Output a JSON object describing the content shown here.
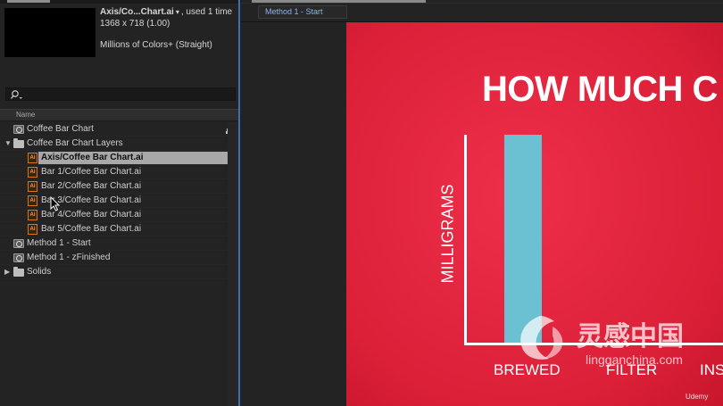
{
  "project": {
    "info": {
      "file_name": "Axis/Co...Chart.ai",
      "caret": "▾",
      "usage": ", used 1 time",
      "dimensions": "1368 x 718 (1.00)",
      "color_mode": "Millions of Colors+ (Straight)"
    },
    "column_header": "Name",
    "items": [
      {
        "label": "Coffee Bar Chart",
        "icon": "composition-icon",
        "indent": 0
      },
      {
        "label": "Coffee Bar Chart Layers",
        "icon": "folder-icon",
        "indent": 0,
        "expanded": true
      },
      {
        "label": "Axis/Coffee Bar Chart.ai",
        "icon": "illustrator-file-icon",
        "indent": 1,
        "selected": true
      },
      {
        "label": "Bar 1/Coffee Bar Chart.ai",
        "icon": "illustrator-file-icon",
        "indent": 1
      },
      {
        "label": "Bar 2/Coffee Bar Chart.ai",
        "icon": "illustrator-file-icon",
        "indent": 1
      },
      {
        "label": "Bar 3/Coffee Bar Chart.ai",
        "icon": "illustrator-file-icon",
        "indent": 1
      },
      {
        "label": "Bar 4/Coffee Bar Chart.ai",
        "icon": "illustrator-file-icon",
        "indent": 1
      },
      {
        "label": "Bar 5/Coffee Bar Chart.ai",
        "icon": "illustrator-file-icon",
        "indent": 1
      },
      {
        "label": "Method 1 - Start",
        "icon": "composition-icon",
        "indent": 0
      },
      {
        "label": "Method 1 - zFinished",
        "icon": "composition-icon",
        "indent": 0
      },
      {
        "label": "Solids",
        "icon": "folder-icon",
        "indent": 0,
        "expanded": false
      }
    ]
  },
  "composition": {
    "tab_label": "Method 1 - Start",
    "headline": "HOW MUCH C",
    "y_axis_label": "MILLIGRAMS",
    "x_labels": [
      "BREWED",
      "FILTER",
      "INS"
    ],
    "bar_color": "#6bc1d2",
    "bar_level": 1.0
  },
  "watermark": {
    "chinese": "灵感中国",
    "url": "lingganchina.com",
    "udemy": "Udemy"
  },
  "colors": {
    "canvas_red": "#e2253f",
    "selection": "#a8a8a8",
    "illustrator_orange": "#d47a1e",
    "tab_blue": "#8ab4f8"
  }
}
